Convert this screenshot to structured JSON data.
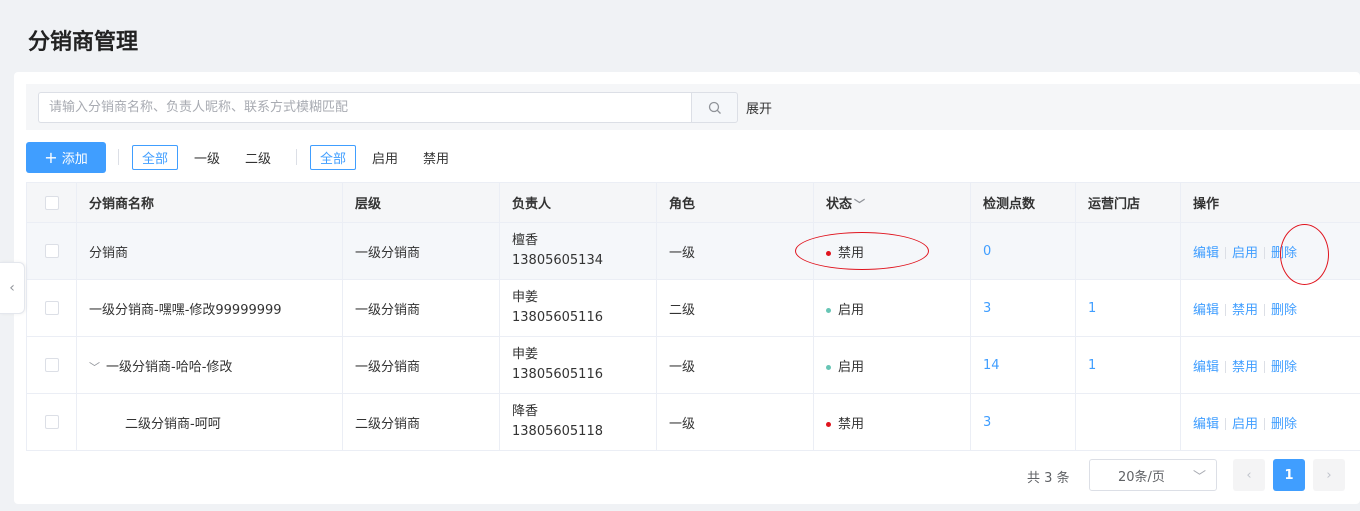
{
  "page": {
    "title": "分销商管理"
  },
  "search": {
    "placeholder": "请输入分销商名称、负责人昵称、联系方式模糊匹配",
    "value": "",
    "expand_label": "展开"
  },
  "toolbar": {
    "add_label": "添加",
    "level_filters": [
      "全部",
      "一级",
      "二级"
    ],
    "status_filters": [
      "全部",
      "启用",
      "禁用"
    ]
  },
  "table": {
    "columns": [
      "分销商名称",
      "层级",
      "负责人",
      "角色",
      "状态",
      "检测点数",
      "运营门店",
      "操作"
    ],
    "rows": [
      {
        "name": "分销商",
        "level": "一级分销商",
        "contact_name": "檀香",
        "phone": "13805605134",
        "role": "一级",
        "status": "禁用",
        "points": "0",
        "stores": "",
        "actions": [
          "编辑",
          "启用",
          "删除"
        ]
      },
      {
        "name": "一级分销商-嘿嘿-修改99999999",
        "level": "一级分销商",
        "contact_name": "申姜",
        "phone": "13805605116",
        "role": "二级",
        "status": "启用",
        "points": "3",
        "stores": "1",
        "actions": [
          "编辑",
          "禁用",
          "删除"
        ]
      },
      {
        "name": "一级分销商-哈哈-修改",
        "level": "一级分销商",
        "contact_name": "申姜",
        "phone": "13805605116",
        "role": "一级",
        "status": "启用",
        "points": "14",
        "stores": "1",
        "actions": [
          "编辑",
          "禁用",
          "删除"
        ]
      },
      {
        "name": "二级分销商-呵呵",
        "level": "二级分销商",
        "contact_name": "降香",
        "phone": "13805605118",
        "role": "一级",
        "status": "禁用",
        "points": "3",
        "stores": "",
        "actions": [
          "编辑",
          "启用",
          "删除"
        ]
      }
    ]
  },
  "pagination": {
    "total_label": "共 3 条",
    "page_size": "20条/页",
    "current_page": "1"
  },
  "colors": {
    "primary": "#409eff",
    "enabled": "#67c5b5",
    "disabled": "#e0141e",
    "annotation": "#e0141e"
  }
}
